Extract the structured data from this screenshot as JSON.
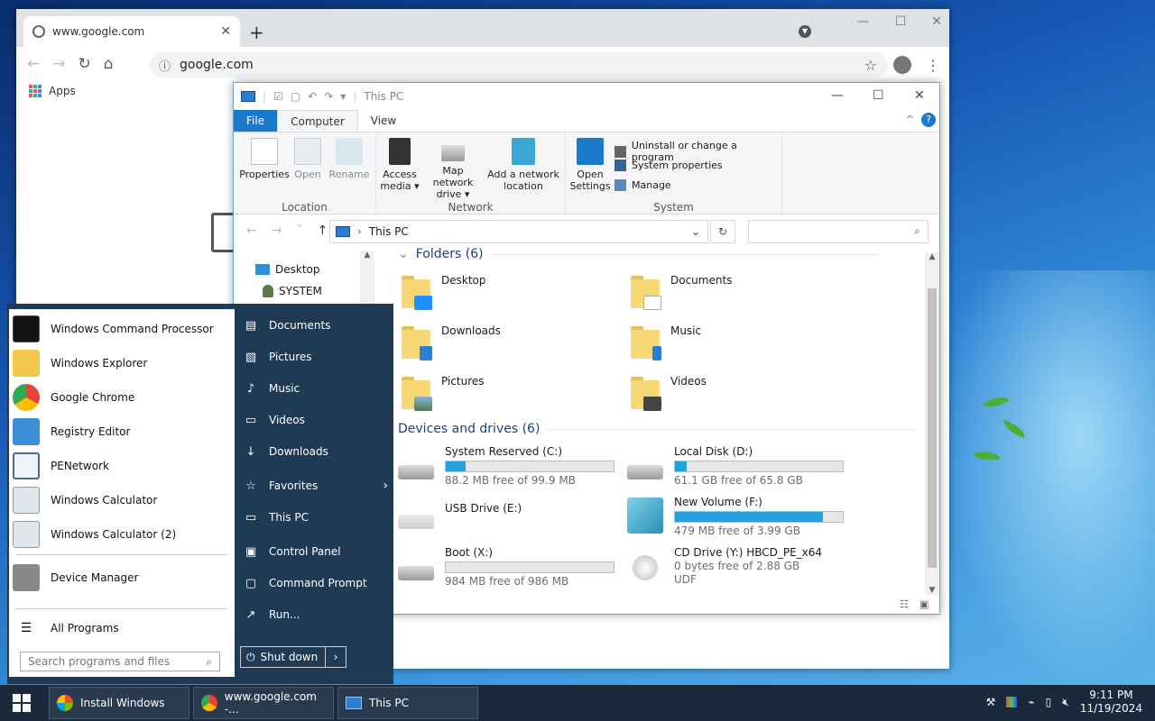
{
  "chrome": {
    "tab_title": "www.google.com",
    "address": "google.com",
    "bookmarks_apps": "Apps"
  },
  "explorer": {
    "title": "This PC",
    "tabs": [
      "File",
      "Computer",
      "View"
    ],
    "ribbon": {
      "location": {
        "label": "Location",
        "properties": "Properties",
        "open": "Open",
        "rename": "Rename"
      },
      "network": {
        "label": "Network",
        "access_media_1": "Access",
        "access_media_2": "media",
        "map_drive_1": "Map network",
        "map_drive_2": "drive",
        "add_location_1": "Add a network",
        "add_location_2": "location"
      },
      "system": {
        "label": "System",
        "open_settings_1": "Open",
        "open_settings_2": "Settings",
        "uninstall": "Uninstall or change a program",
        "system_properties": "System properties",
        "manage": "Manage"
      }
    },
    "breadcrumb": "This PC",
    "nav": {
      "desktop": "Desktop",
      "system": "SYSTEM"
    },
    "folders_header": "Folders (6)",
    "folders": [
      "Desktop",
      "Documents",
      "Downloads",
      "Music",
      "Pictures",
      "Videos"
    ],
    "drives_header": "Devices and drives (6)",
    "drives": [
      {
        "name": "System Reserved (C:)",
        "free": "88.2 MB free of 99.9 MB",
        "used_fraction": 0.12
      },
      {
        "name": "Local Disk (D:)",
        "free": "61.1 GB free of 65.8 GB",
        "used_fraction": 0.07
      },
      {
        "name": "USB Drive (E:)",
        "free": "",
        "used_fraction": null
      },
      {
        "name": "New Volume (F:)",
        "free": "479 MB free of 3.99 GB",
        "used_fraction": 0.88
      },
      {
        "name": "Boot (X:)",
        "free": "984 MB free of 986 MB",
        "used_fraction": 0.0
      },
      {
        "name": "CD Drive (Y:) HBCD_PE_x64",
        "free": "0 bytes free of 2.88 GB",
        "extra": "UDF",
        "used_fraction": null
      }
    ]
  },
  "start_menu": {
    "programs": [
      "Windows Command Processor",
      "Windows Explorer",
      "Google Chrome",
      "Registry Editor",
      "PENetwork",
      "Windows Calculator",
      "Windows Calculator (2)",
      "Device Manager"
    ],
    "all_programs": "All Programs",
    "search_placeholder": "Search programs and files",
    "places": [
      "Documents",
      "Pictures",
      "Music",
      "Videos",
      "Downloads",
      "Favorites",
      "This PC",
      "Control Panel",
      "Command Prompt",
      "Run..."
    ],
    "shutdown": "Shut down"
  },
  "taskbar": {
    "buttons": [
      "Install Windows",
      "www.google.com -...",
      "This PC"
    ],
    "time": "9:11 PM",
    "date": "11/19/2024"
  },
  "colors": {
    "accent": "#1979ca",
    "start_bg": "#1f3a55",
    "taskbar_bg": "#1a2a3c",
    "drive_bar": "#26a0da"
  }
}
